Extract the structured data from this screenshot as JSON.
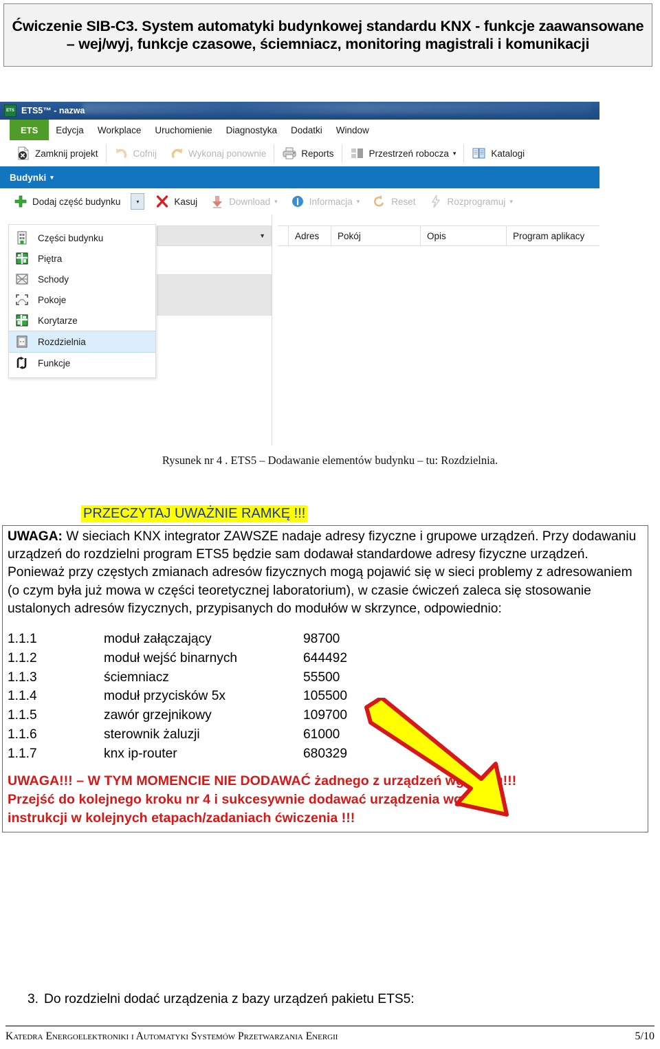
{
  "header": {
    "title": "Ćwiczenie SIB-C3. System automatyki budynkowej standardu KNX - funkcje zaawansowane – wej/wyj, funkcje czasowe, ściemniacz, monitoring magistrali i komunikacji"
  },
  "screenshot": {
    "window_title": "ETS5™ - nazwa",
    "logo_label": "ETS",
    "menubar": {
      "active_tab": "ETS",
      "items": [
        {
          "label": "Edycja"
        },
        {
          "label": "Workplace"
        },
        {
          "label": "Uruchomienie"
        },
        {
          "label": "Diagnostyka"
        },
        {
          "label": "Dodatki"
        },
        {
          "label": "Window"
        }
      ]
    },
    "toolbar": [
      {
        "label": "Zamknij projekt",
        "icon": "close-project-icon",
        "enabled": true
      },
      {
        "label": "Cofnij",
        "icon": "undo-icon",
        "enabled": false
      },
      {
        "label": "Wykonaj ponownie",
        "icon": "redo-icon",
        "enabled": false
      },
      {
        "label": "Reports",
        "icon": "printer-icon",
        "enabled": true
      },
      {
        "label": "Przestrzeń robocza",
        "icon": "workspace-icon",
        "enabled": true,
        "caret": "▾"
      },
      {
        "label": "Katalogi",
        "icon": "catalog-book-icon",
        "enabled": true
      }
    ],
    "blue_strip": {
      "label": "Budynki",
      "caret": "▾"
    },
    "toolbar2": [
      {
        "label": "Dodaj część budynku",
        "icon": "plus-icon",
        "enabled": true
      },
      {
        "label": "Kasuj",
        "icon": "delete-x-icon",
        "enabled": true
      },
      {
        "label": "Download",
        "icon": "download-icon",
        "enabled": false,
        "caret": "▾"
      },
      {
        "label": "Informacja",
        "icon": "info-icon",
        "enabled": false,
        "caret": "▾"
      },
      {
        "label": "Reset",
        "icon": "reset-icon",
        "enabled": false
      },
      {
        "label": "Rozprogramuj",
        "icon": "unload-icon",
        "enabled": false,
        "caret": "▾"
      }
    ],
    "grid_headers": [
      "Adres",
      "Pokój",
      "Opis",
      "Program aplikacy"
    ],
    "dropdown_menu": {
      "items": [
        {
          "label": "Części budynku",
          "icon": "building-part-icon",
          "selected": false
        },
        {
          "label": "Piętra",
          "icon": "floor-icon",
          "selected": false
        },
        {
          "label": "Schody",
          "icon": "stairs-icon",
          "selected": false
        },
        {
          "label": "Pokoje",
          "icon": "room-icon",
          "selected": false
        },
        {
          "label": "Korytarze",
          "icon": "corridor-icon",
          "selected": false
        },
        {
          "label": "Rozdzielnia",
          "icon": "cabinet-icon",
          "selected": true
        },
        {
          "label": "Funkcje",
          "icon": "function-icon",
          "selected": false
        }
      ]
    }
  },
  "caption": "Rysunek nr 4 . ETS5 – Dodawanie elementów budynku – tu: Rozdzielnia.",
  "read_frame_notice": "PRZECZYTAJ UWAŻNIE RAMKĘ !!!",
  "uwaga": {
    "label": "UWAGA:",
    "body": " W sieciach KNX integrator ZAWSZE nadaje adresy fizyczne i grupowe urządzeń. Przy dodawaniu urządzeń do rozdzielni program ETS5 będzie sam dodawał standardowe adresy fizyczne urządzeń. Ponieważ przy częstych zmianach adresów fizycznych mogą pojawić się w sieci problemy z adresowaniem (o czym była już mowa w części teoretycznej laboratorium), w czasie ćwiczeń zaleca się stosowanie ustalonych adresów fizycznych, przypisanych do modułów w skrzynce, odpowiednio:"
  },
  "devices": [
    {
      "address": "1.1.1",
      "name": "moduł załączający",
      "number": "98700"
    },
    {
      "address": "1.1.2",
      "name": "moduł wejść binarnych",
      "number": "644492"
    },
    {
      "address": "1.1.3",
      "name": "ściemniacz",
      "number": "55500"
    },
    {
      "address": "1.1.4",
      "name": "moduł przycisków 5x",
      "number": "105500"
    },
    {
      "address": "1.1.5",
      "name": "zawór grzejnikowy",
      "number": "109700"
    },
    {
      "address": "1.1.6",
      "name": "sterownik żaluzji",
      "number": "61000"
    },
    {
      "address": "1.1.7",
      "name": "knx ip-router",
      "number": "680329"
    }
  ],
  "red_warning": {
    "line1": "UWAGA!!! – W TYM MOMENCIE NIE DODAWAĆ żadnego z urządzeń wg spisu!!!",
    "line2": "Przejść do kolejnego kroku nr 4 i sukcesywnie dodawać urządzenia wg",
    "line3": "instrukcji w kolejnych etapach/zadaniach ćwiczenia !!!"
  },
  "step3": {
    "number": "3.",
    "text": "Do rozdzielni dodać urządzenia z bazy urządzeń pakietu ETS5:"
  },
  "footer": {
    "left": "Katedra Energoelektroniki i Automatyki Systemów Przetwarzania Energii",
    "page": "5/10"
  },
  "colors": {
    "highlight": "#ffff00",
    "warning_red": "#d81717",
    "ets_green": "#4f9c29",
    "ets_blue": "#1275c0",
    "titlebar_blue": "#21518c"
  },
  "arrow": {
    "fill": "#ffff00",
    "stroke": "#d81717"
  }
}
